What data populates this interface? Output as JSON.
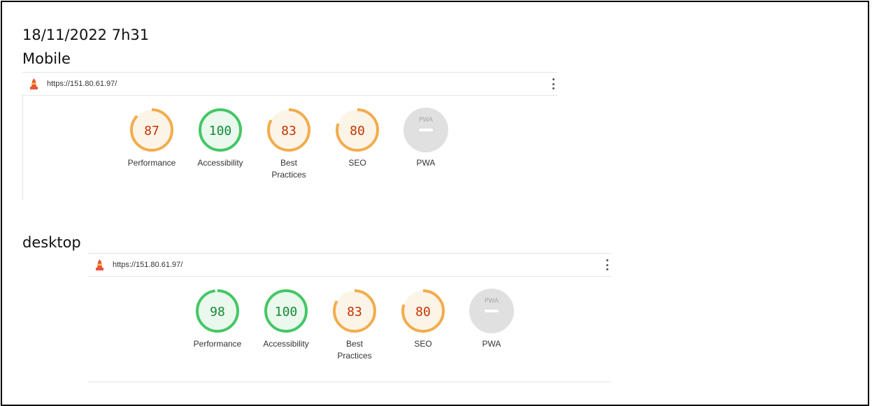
{
  "header": {
    "timestamp": "18/11/2022 7h31",
    "mobile_label": "Mobile",
    "desktop_label": "desktop"
  },
  "mobile": {
    "url": "https://151.80.61.97/",
    "gauges": [
      {
        "score": "87",
        "label": "Performance",
        "status": "average"
      },
      {
        "score": "100",
        "label": "Accessibility",
        "status": "pass"
      },
      {
        "score": "83",
        "label": "Best\nPractices",
        "status": "average"
      },
      {
        "score": "80",
        "label": "SEO",
        "status": "average"
      },
      {
        "score": "PWA",
        "label": "PWA",
        "status": "na"
      }
    ]
  },
  "desktop": {
    "url": "https://151.80.61.97/",
    "gauges": [
      {
        "score": "98",
        "label": "Performance",
        "status": "pass"
      },
      {
        "score": "100",
        "label": "Accessibility",
        "status": "pass"
      },
      {
        "score": "83",
        "label": "Best\nPractices",
        "status": "average"
      },
      {
        "score": "80",
        "label": "SEO",
        "status": "average"
      },
      {
        "score": "PWA",
        "label": "PWA",
        "status": "na"
      }
    ]
  },
  "colors": {
    "pass_stroke": "#44c765",
    "pass_fill": "#eaf8ee",
    "pass_text": "#138a34",
    "average_stroke": "#f2ac4d",
    "average_fill": "#fdf4e8",
    "average_text": "#c33300",
    "na_fill": "#e0e0e0",
    "na_text": "#a8a8a8",
    "na_bar": "#ffffff",
    "lighthouse_red": "#e9553a",
    "lighthouse_yellow": "#f7c34c"
  }
}
